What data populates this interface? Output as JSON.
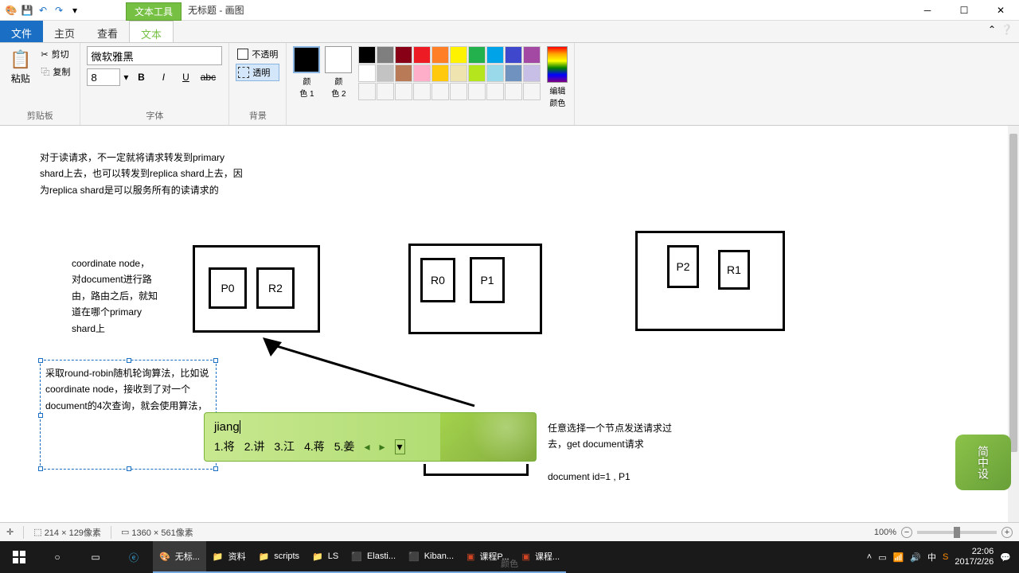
{
  "title": {
    "context_tab": "文本工具",
    "doc": "无标题 - 画图"
  },
  "menu": {
    "file": "文件",
    "home": "主页",
    "view": "查看",
    "text": "文本"
  },
  "ribbon": {
    "clipboard": {
      "label": "剪贴板",
      "paste": "粘贴",
      "cut": "剪切",
      "copy": "复制"
    },
    "font": {
      "label": "字体",
      "family": "微软雅黑",
      "size": "8"
    },
    "bg": {
      "label": "背景",
      "opaque": "不透明",
      "transparent": "透明"
    },
    "colors": {
      "label": "颜色",
      "c1": "颜\n色 1",
      "c2": "颜\n色 2",
      "edit": "编辑\n颜色"
    }
  },
  "canvas": {
    "text1": "对于读请求，不一定就将请求转发到primary\nshard上去，也可以转发到replica shard上去，因\n为replica shard是可以服务所有的读请求的",
    "text2": "coordinate node，\n对document进行路\n由，路由之后，就知\n道在哪个primary\nshard上",
    "text3": "采取round-robin随机轮询算法，比如说\ncoordinate node，接收到了对一个\ndocument的4次查询，就会使用算法，",
    "text4": "任意选择一个节点发送请求过\n去，get document请求\n\ndocument id=1 , P1",
    "shards": {
      "p0": "P0",
      "r2": "R2",
      "r0": "R0",
      "p1": "P1",
      "p2": "P2",
      "r1": "R1"
    }
  },
  "ime": {
    "input": "jiang",
    "c1": "1.将",
    "c2": "2.讲",
    "c3": "3.江",
    "c4": "4.蒋",
    "c5": "5.姜"
  },
  "ime_badge": "简中设",
  "status": {
    "sel": "214 × 129像素",
    "canvas": "1360 × 561像素",
    "zoom": "100%"
  },
  "taskbar": {
    "apps": [
      {
        "label": "无标..."
      },
      {
        "label": "资料"
      },
      {
        "label": "scripts"
      },
      {
        "label": "LS"
      },
      {
        "label": "Elasti..."
      },
      {
        "label": "Kiban..."
      },
      {
        "label": "课程P..."
      },
      {
        "label": "课程..."
      }
    ],
    "time": "22:06",
    "date": "2017/2/26"
  },
  "palette_row1": [
    "#000",
    "#7f7f7f",
    "#880015",
    "#ed1c24",
    "#ff7f27",
    "#fff200",
    "#22b14c",
    "#00a2e8",
    "#3f48cc",
    "#a349a4"
  ],
  "palette_row2": [
    "#fff",
    "#c3c3c3",
    "#b97a57",
    "#ffaec9",
    "#ffc90e",
    "#efe4b0",
    "#b5e61d",
    "#99d9ea",
    "#7092be",
    "#c8bfe7"
  ]
}
